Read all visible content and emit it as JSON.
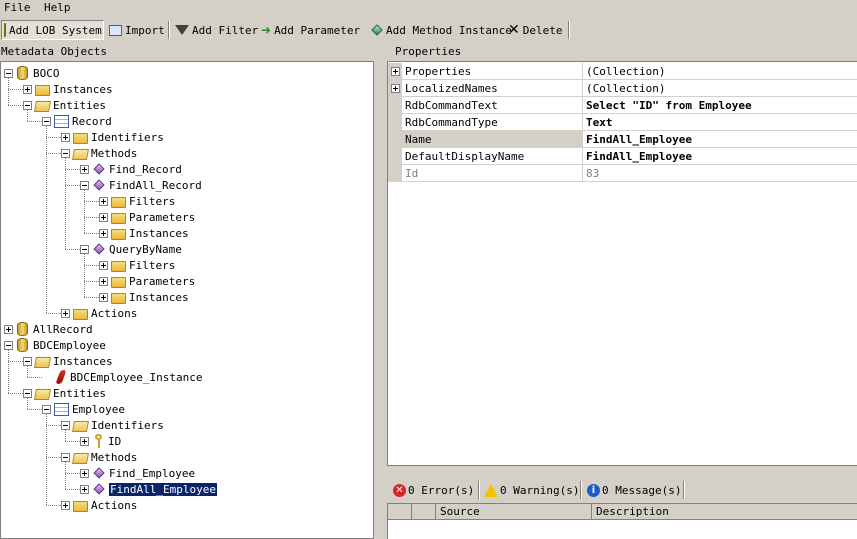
{
  "menu": [
    "File",
    "Help"
  ],
  "toolbar": {
    "add_lob_system": "Add LOB System",
    "import": "Import",
    "add_filter": "Add Filter",
    "add_parameter": "Add  Parameter",
    "add_method_instance": "Add Method Instance",
    "delete": "Delete"
  },
  "left_panel": {
    "title": "Metadata Objects"
  },
  "tree": [
    {
      "label": "BOCO",
      "icon": "database-icon",
      "expander": "minus"
    },
    {
      "label": "Instances",
      "icon": "folder-icon",
      "expander": "plus"
    },
    {
      "label": "Entities",
      "icon": "folder-open-icon",
      "expander": "minus"
    },
    {
      "label": "Record",
      "icon": "entity-icon",
      "expander": "minus"
    },
    {
      "label": "Identifiers",
      "icon": "folder-icon",
      "expander": "plus"
    },
    {
      "label": "Methods",
      "icon": "folder-open-icon",
      "expander": "minus"
    },
    {
      "label": "Find_Record",
      "icon": "method-icon",
      "expander": "plus"
    },
    {
      "label": "FindAll_Record",
      "icon": "method-icon",
      "expander": "minus"
    },
    {
      "label": "Filters",
      "icon": "folder-icon",
      "expander": "plus"
    },
    {
      "label": "Parameters",
      "icon": "folder-icon",
      "expander": "plus"
    },
    {
      "label": "Instances",
      "icon": "folder-icon",
      "expander": "plus"
    },
    {
      "label": "QueryByName",
      "icon": "method-icon",
      "expander": "minus"
    },
    {
      "label": "Filters",
      "icon": "folder-icon",
      "expander": "plus"
    },
    {
      "label": "Parameters",
      "icon": "folder-icon",
      "expander": "plus"
    },
    {
      "label": "Instances",
      "icon": "folder-icon",
      "expander": "plus"
    },
    {
      "label": "Actions",
      "icon": "folder-icon",
      "expander": "plus"
    },
    {
      "label": "AllRecord",
      "icon": "database-icon",
      "expander": "plus"
    },
    {
      "label": "BDCEmployee",
      "icon": "database-icon",
      "expander": "minus"
    },
    {
      "label": "Instances",
      "icon": "folder-open-icon",
      "expander": "minus"
    },
    {
      "label": "BDCEmployee_Instance",
      "icon": "instance-icon",
      "expander": "none"
    },
    {
      "label": "Entities",
      "icon": "folder-open-icon",
      "expander": "minus"
    },
    {
      "label": "Employee",
      "icon": "entity-icon",
      "expander": "minus"
    },
    {
      "label": "Identifiers",
      "icon": "folder-open-icon",
      "expander": "minus"
    },
    {
      "label": "ID",
      "icon": "key-icon",
      "expander": "plus"
    },
    {
      "label": "Methods",
      "icon": "folder-open-icon",
      "expander": "minus"
    },
    {
      "label": "Find_Employee",
      "icon": "method-icon",
      "expander": "plus"
    },
    {
      "label": "FindAll_Employee",
      "icon": "method-icon",
      "expander": "plus",
      "selected": true
    },
    {
      "label": "Actions",
      "icon": "folder-icon",
      "expander": "plus"
    }
  ],
  "properties": {
    "title": "Properties",
    "rows": [
      {
        "name": "Properties",
        "value": "(Collection)",
        "expandable": true,
        "style": "normal"
      },
      {
        "name": "LocalizedNames",
        "value": "(Collection)",
        "expandable": true,
        "style": "normal"
      },
      {
        "name": "RdbCommandText",
        "value": "Select \"ID\" from  Employee",
        "expandable": false,
        "style": "bold"
      },
      {
        "name": "RdbCommandType",
        "value": "Text",
        "expandable": false,
        "style": "bold"
      },
      {
        "name": "Name",
        "value": "FindAll_Employee",
        "expandable": false,
        "style": "bold",
        "highlighted": true
      },
      {
        "name": "DefaultDisplayName",
        "value": "FindAll_Employee",
        "expandable": false,
        "style": "bold"
      },
      {
        "name": "Id",
        "value": "83",
        "expandable": false,
        "style": "gray"
      }
    ]
  },
  "errors": {
    "error_label": "0 Error(s)",
    "warning_label": "0 Warning(s)",
    "message_label": "0 Message(s)",
    "columns": [
      "",
      "",
      "Source",
      "Description"
    ]
  }
}
